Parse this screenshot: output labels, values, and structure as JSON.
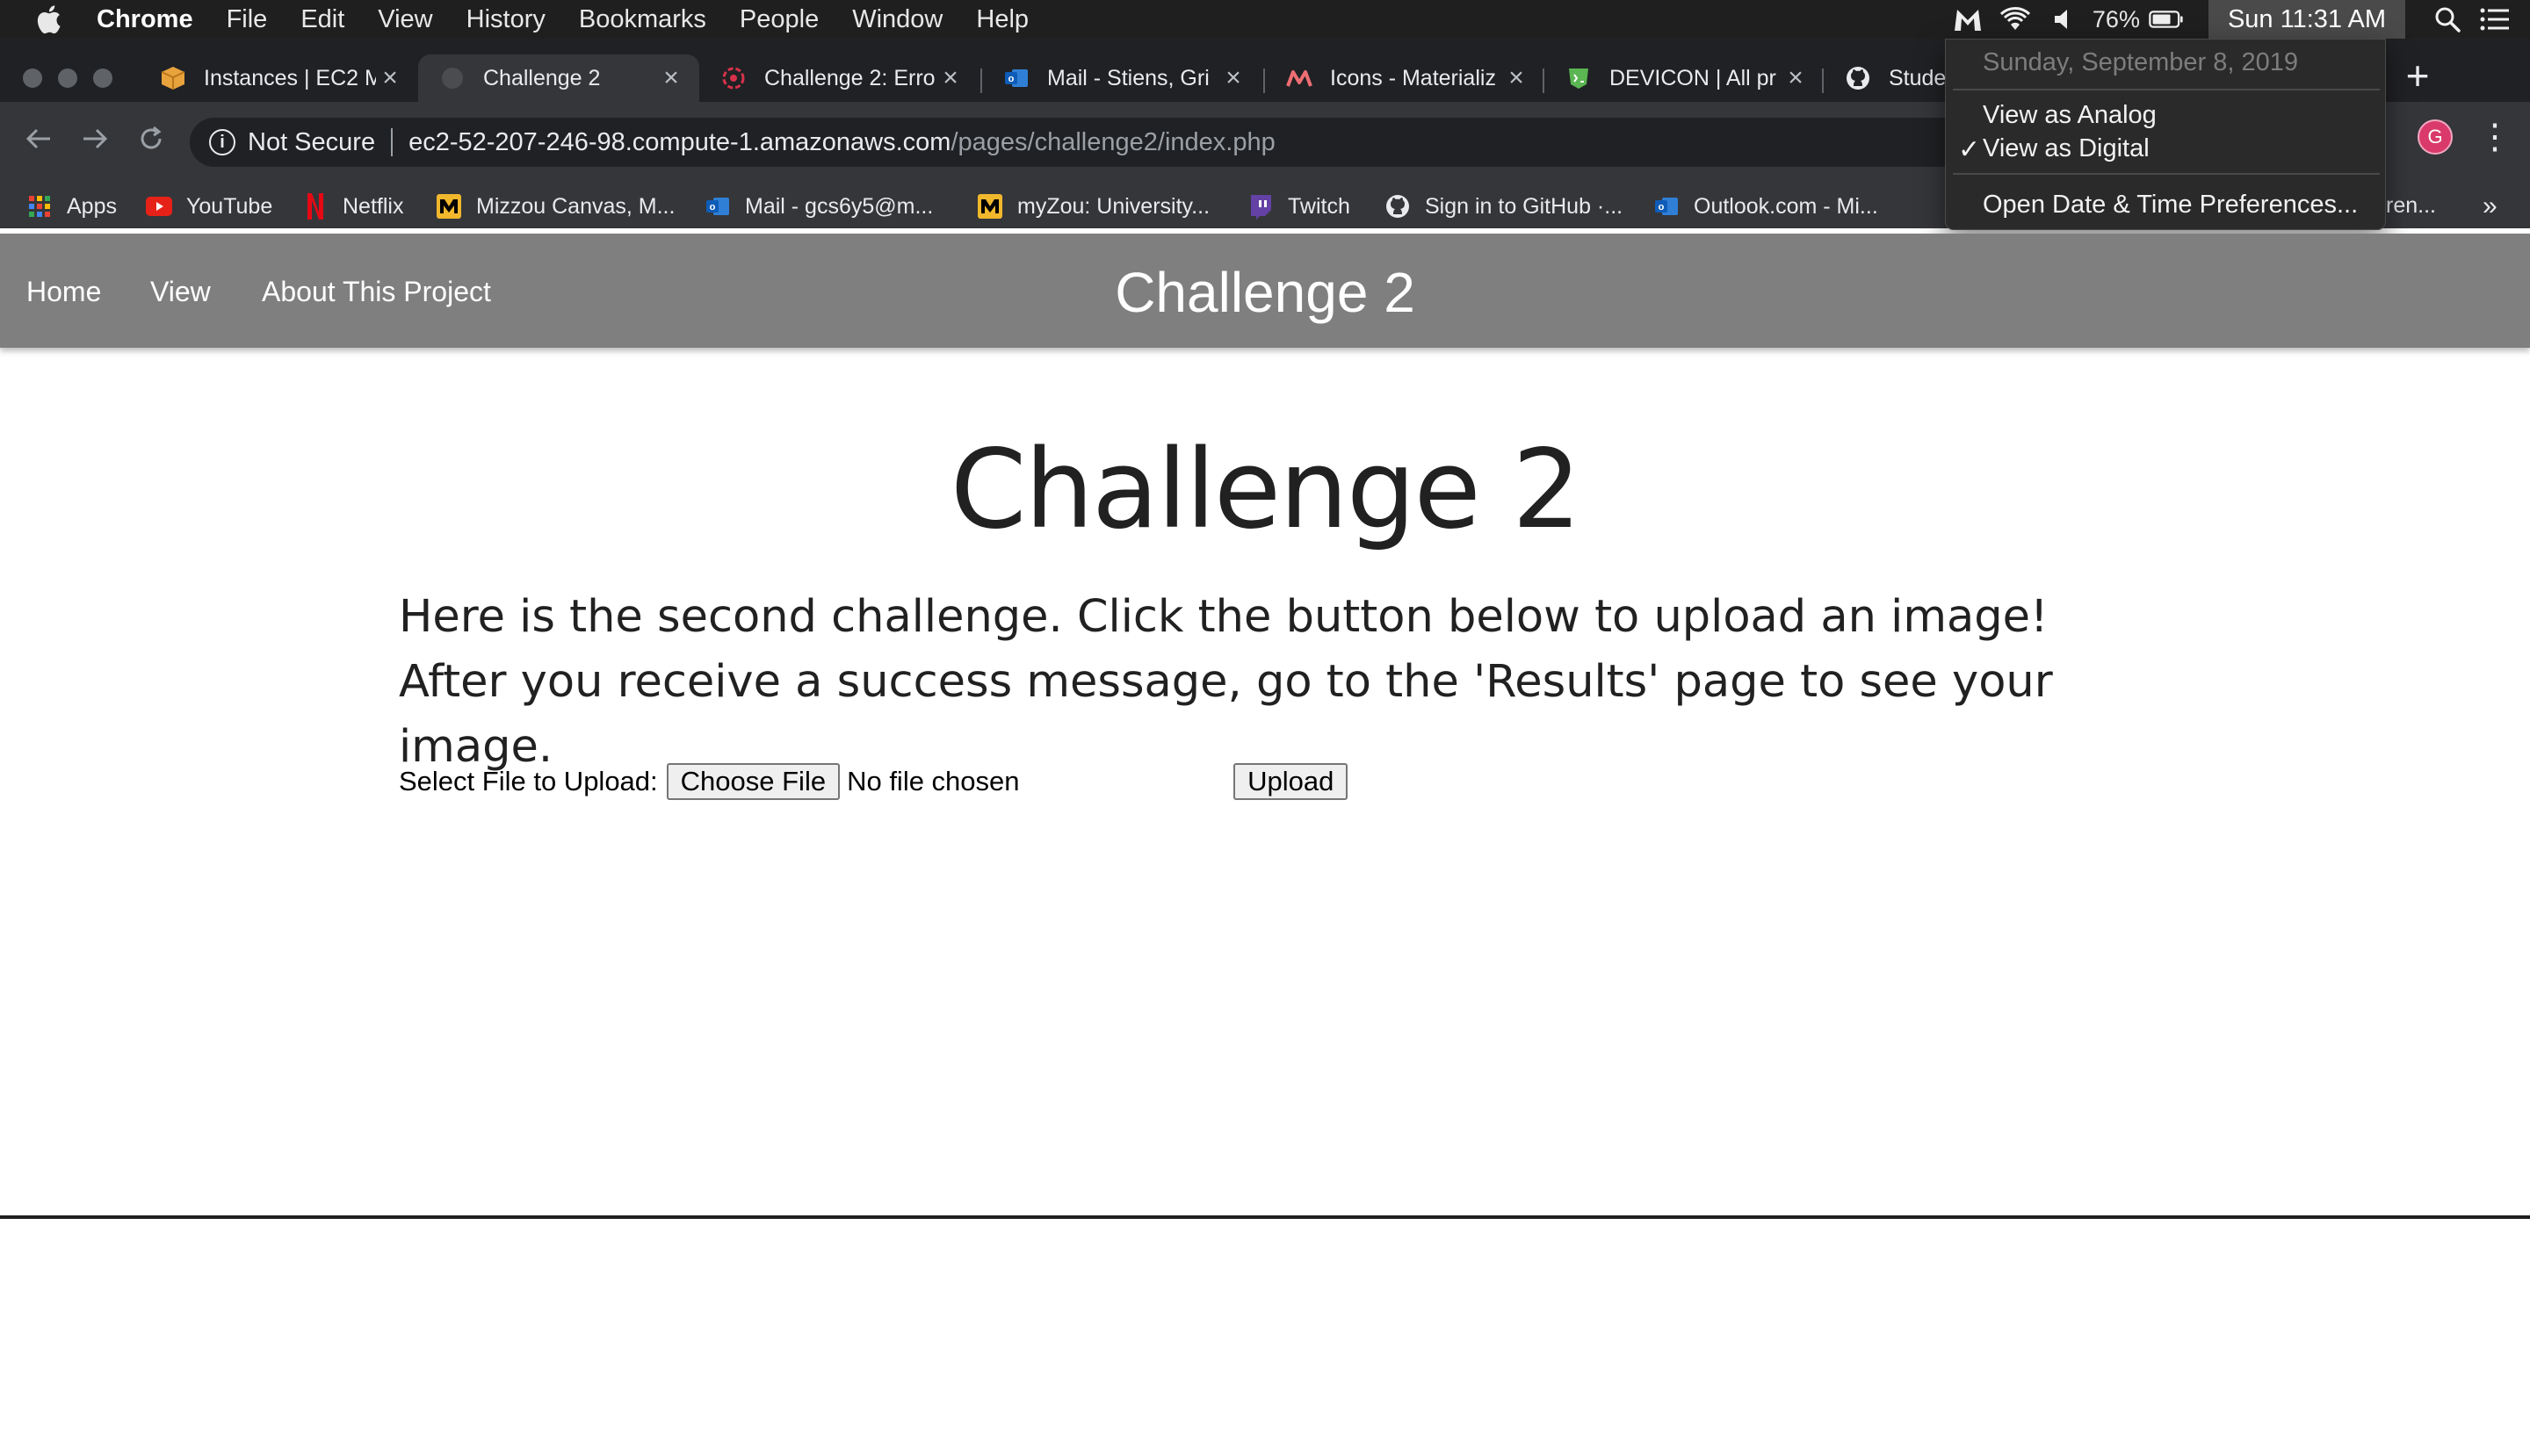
{
  "menubar": {
    "app": "Chrome",
    "menus": [
      "File",
      "Edit",
      "View",
      "History",
      "Bookmarks",
      "People",
      "Window",
      "Help"
    ],
    "battery": "76%",
    "clock": "Sun 11:31 AM"
  },
  "tabs": [
    {
      "title": "Instances | EC2 M",
      "icon": "aws-box-icon"
    },
    {
      "title": "Challenge 2",
      "icon": "page-globe-icon",
      "active": true
    },
    {
      "title": "Challenge 2: Erro",
      "icon": "debian-swirl-icon"
    },
    {
      "title": "Mail - Stiens, Gri",
      "icon": "outlook-icon"
    },
    {
      "title": "Icons - Materializ",
      "icon": "materialize-icon"
    },
    {
      "title": "DEVICON | All pr",
      "icon": "devicon-shield-icon"
    },
    {
      "title": "Studen",
      "icon": "github-icon"
    }
  ],
  "omnibox": {
    "security": "Not Secure",
    "host": "ec2-52-207-246-98.compute-1.amazonaws.com",
    "path": "/pages/challenge2/index.php"
  },
  "profile_initial": "G",
  "bookmarks": [
    {
      "label": "Apps",
      "icon": "apps-grid-icon"
    },
    {
      "label": "YouTube",
      "icon": "youtube-icon"
    },
    {
      "label": "Netflix",
      "icon": "netflix-icon"
    },
    {
      "label": "Mizzou Canvas, M...",
      "icon": "mizzou-icon"
    },
    {
      "label": "Mail - gcs6y5@m...",
      "icon": "outlook-icon"
    },
    {
      "label": "myZou: University...",
      "icon": "mizzou-icon"
    },
    {
      "label": "Twitch",
      "icon": "twitch-icon"
    },
    {
      "label": "Sign in to GitHub ·...",
      "icon": "github-icon"
    },
    {
      "label": "Outlook.com - Mi...",
      "icon": "outlook-icon"
    },
    {
      "label": "ren...",
      "icon": ""
    }
  ],
  "datetime_menu": {
    "date": "Sunday, September 8, 2019",
    "view_analog": "View as Analog",
    "view_digital": "View as Digital",
    "check": "✓",
    "preferences": "Open Date & Time Preferences..."
  },
  "site": {
    "nav": [
      "Home",
      "View",
      "About This Project"
    ],
    "brand": "Challenge 2",
    "heading": "Challenge 2",
    "description": "Here is the second challenge. Click the button below to upload an image! After you receive a success message, go to the 'Results' page to see your image.",
    "upload_label": "Select File to Upload:",
    "choose_file": "Choose File",
    "no_file": "No file chosen",
    "upload_button": "Upload"
  }
}
